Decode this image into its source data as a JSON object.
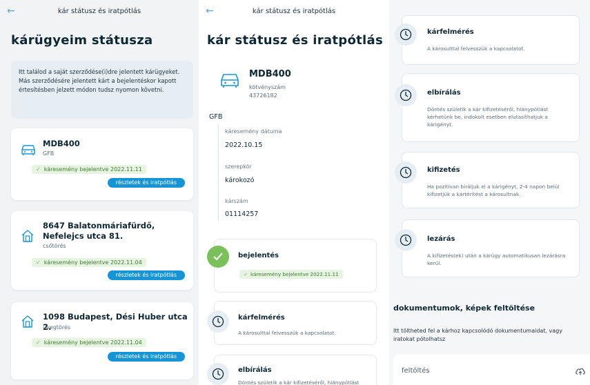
{
  "colors": {
    "accent": "#1595d6",
    "success": "#7ac15c",
    "title": "#0d2733"
  },
  "screen1": {
    "header_title": "kár státusz és iratpótlás",
    "page_title": "kárügyeim státusza",
    "info_text": "Itt találod a saját szerződése(i)dre jelentett kárügyeket. Más szerződésére jelentett kárt a bejelentéskor kapott értesítésben jelzett módon tudsz nyomon követni.",
    "claims": [
      {
        "icon": "car-icon",
        "title": "MDB400",
        "subtitle": "GFB",
        "status": "káresemény bejelentve 2022.11.11",
        "button": "részletek és iratpótlás"
      },
      {
        "icon": "house-icon",
        "title": "8647 Balatonmáriafürdő, Nefelejcs utca 81.",
        "subtitle": "csőtörés",
        "status": "káresemény bejelentve 2022.11.04",
        "button": "részletek és iratpótlás"
      },
      {
        "icon": "house-icon",
        "title": "1098 Budapest, Dési Huber utca 2.",
        "subtitle": "üvegtörés",
        "status": "káresemény bejelentve 2022.11.04",
        "button": "részletek és iratpótlás"
      }
    ]
  },
  "screen2": {
    "header_title": "kár státusz és iratpótlás",
    "page_title": "kár státusz és iratpótlás",
    "plate": "MDB400",
    "policy_label": "kötvényszám",
    "policy_number": "43726182",
    "product": "GFB",
    "fields": [
      {
        "label": "káresemény dátuma",
        "value": "2022.10.15"
      },
      {
        "label": "szerepkör",
        "value": "károkozó"
      },
      {
        "label": "kárszám",
        "value": "01114257"
      }
    ],
    "steps": [
      {
        "title": "bejelentés",
        "status": "káresemény bejelentve 2022.11.11"
      },
      {
        "title": "kárfelmérés",
        "desc": "A károsulttal felvesszük a kapcsolatot."
      },
      {
        "title": "elbírálás",
        "desc": "Döntés születik a kár kifizetéséről, hiánypótlást"
      }
    ]
  },
  "screen3": {
    "steps": [
      {
        "title": "kárfelmérés",
        "desc": "A károsulttal felvesszük a kapcsolatot."
      },
      {
        "title": "elbírálás",
        "desc": "Döntés születik a kár kifizetéséről, hiánypótlást kérhetünk be, indokolt esetben elutasíthatjuk a kárigényt."
      },
      {
        "title": "kifizetés",
        "desc": "Ha pozitívan bíráljuk el a kárigényt, 2-4 napon belül kifizetjük a kártérítést a károsultnak."
      },
      {
        "title": "lezárás",
        "desc": "A kifizetés(ek) után a kárügy automatikusan lezárásra kerül."
      }
    ],
    "docs_title": "dokumentumok, képek feltöltése",
    "docs_text": "Itt töltheted fel a kárhoz kapcsolódó dokumentumaidat, vagy iratokat pótolhatsz",
    "upload_label": "feltöltés"
  }
}
